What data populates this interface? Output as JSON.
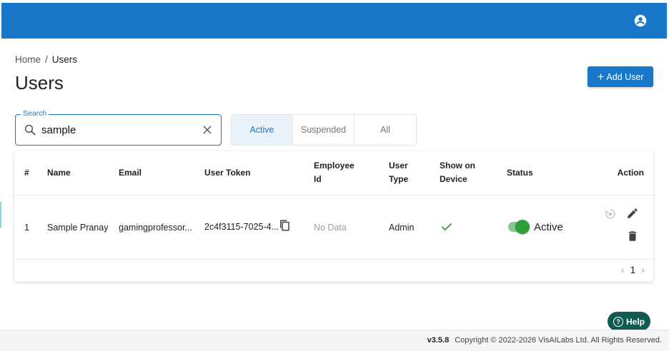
{
  "breadcrumb": {
    "home": "Home",
    "separator": "/",
    "current": "Users"
  },
  "page": {
    "title": "Users",
    "add_button_label": "Add User"
  },
  "search": {
    "label": "Search",
    "value": "sample"
  },
  "tabs": [
    {
      "label": "Active",
      "active": true
    },
    {
      "label": "Suspended",
      "active": false
    },
    {
      "label": "All",
      "active": false
    }
  ],
  "table": {
    "headers": {
      "index": "#",
      "name": "Name",
      "email": "Email",
      "token": "User Token",
      "employee_id_1": "Employee",
      "employee_id_2": "Id",
      "user_type_1": "User",
      "user_type_2": "Type",
      "show_on_device_1": "Show on",
      "show_on_device_2": "Device",
      "status": "Status",
      "action": "Action"
    },
    "rows": [
      {
        "index": "1",
        "name": "Sample Pranay",
        "email": "gamingprofessor...",
        "token": "2c4f3115-7025-4...",
        "employee_id": "No Data",
        "user_type": "Admin",
        "show_on_device": true,
        "status": "Active"
      }
    ]
  },
  "pagination": {
    "current_page": "1"
  },
  "help": {
    "label": "Help"
  },
  "footer": {
    "version": "v3.5.8",
    "copyright": "Copyright © 2022-2026 VisAILabs Ltd. All Rights Reserved."
  },
  "colors": {
    "primary": "#1877c9",
    "help": "#0f5b52",
    "toggle_on": "#2e9e3a",
    "check": "#2e9e3a"
  }
}
